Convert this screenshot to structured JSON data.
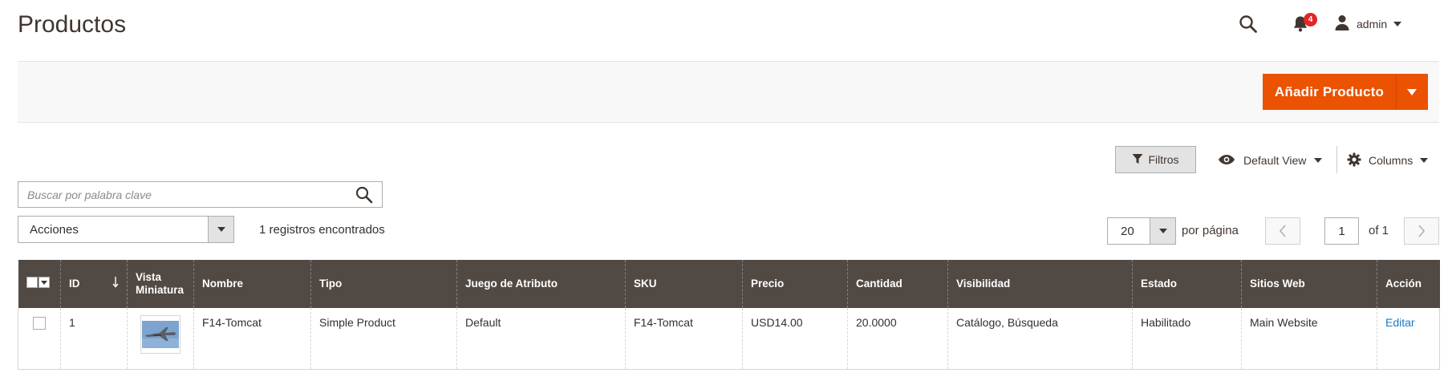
{
  "page": {
    "title": "Productos"
  },
  "header": {
    "notification_count": "4",
    "user_name": "admin"
  },
  "action_bar": {
    "add_product_label": "Añadir Producto"
  },
  "toolbar": {
    "filters_label": "Filtros",
    "view_label": "Default View",
    "columns_label": "Columns",
    "search_placeholder": "Buscar por palabra clave",
    "actions_label": "Acciones",
    "records_found": "1 registros encontrados",
    "per_page_value": "20",
    "per_page_label": "por página",
    "current_page": "1",
    "total_pages": "of 1"
  },
  "grid": {
    "columns": [
      "ID",
      "Vista Miniatura",
      "Nombre",
      "Tipo",
      "Juego de Atributo",
      "SKU",
      "Precio",
      "Cantidad",
      "Visibilidad",
      "Estado",
      "Sitios Web",
      "Acción"
    ],
    "rows": [
      {
        "id": "1",
        "thumbnail_icon": "jet-aircraft-photo",
        "name": "F14-Tomcat",
        "type": "Simple Product",
        "attribute_set": "Default",
        "sku": "F14-Tomcat",
        "price": "USD14.00",
        "quantity": "20.0000",
        "visibility": "Catálogo, Búsqueda",
        "status": "Habilitado",
        "websites": "Main Website",
        "action": "Editar"
      }
    ]
  },
  "colors": {
    "accent": "#eb5202",
    "header_bg": "#514943",
    "link": "#1979c3",
    "badge": "#e22626"
  },
  "icons": {
    "search": "search-icon",
    "notifications": "bell-icon",
    "user": "user-icon",
    "filter": "funnel-icon",
    "view": "eye-icon",
    "columns": "gear-icon",
    "sort": "arrow-down-icon",
    "prev": "chevron-left-icon",
    "next": "chevron-right-icon"
  }
}
